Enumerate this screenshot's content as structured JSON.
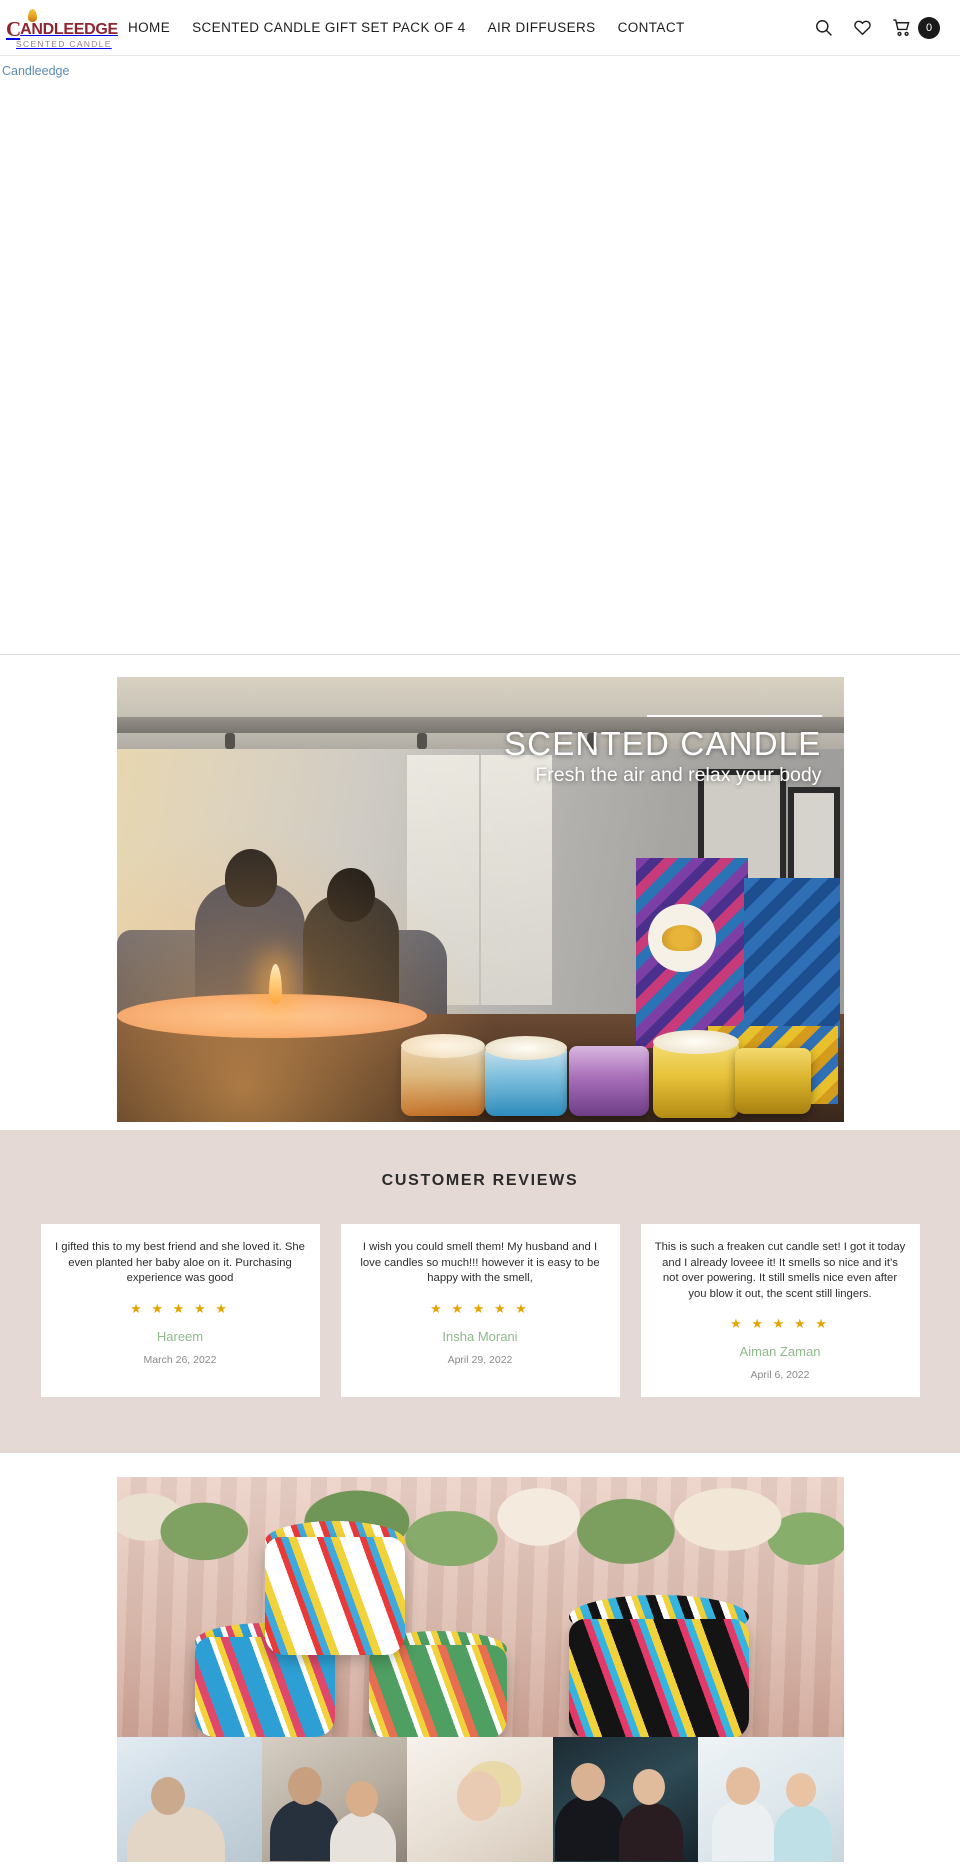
{
  "header": {
    "logo": {
      "initial": "C",
      "name": "ANDLEEDGE",
      "tagline": "SCENTED CANDLE",
      "icon": "candle-flame-icon"
    },
    "nav": [
      {
        "label": "HOME",
        "name": "nav-home"
      },
      {
        "label": "SCENTED CANDLE GIFT SET PACK OF 4",
        "name": "nav-gift-set"
      },
      {
        "label": "AIR DIFFUSERS",
        "name": "nav-air-diffusers"
      },
      {
        "label": "CONTACT",
        "name": "nav-contact"
      }
    ],
    "icons": {
      "search": "search-icon",
      "wishlist": "heart-icon",
      "cart": "shopping-cart-icon"
    },
    "cart_count": "0"
  },
  "breadcrumb": {
    "link_label": "Candleedge"
  },
  "hero": {
    "title": "SCENTED CANDLE",
    "subtitle": "Fresh the air and relax your body"
  },
  "reviews": {
    "heading": "CUSTOMER REVIEWS",
    "items": [
      {
        "text": "I gifted this to my best friend and she loved it. She even planted her baby aloe on it. Purchasing experience was good",
        "stars": "★ ★ ★ ★ ★",
        "author": "Hareem",
        "date": "March 26, 2022"
      },
      {
        "text": "I wish you could smell them! My husband and I love candles so much!!! however it is easy to be happy with the smell,",
        "stars": "★ ★ ★ ★ ★",
        "author": "Insha Morani",
        "date": "April 29, 2022"
      },
      {
        "text": "This is such a freaken cut candle set! I got it today and I already loveee it! It smells so nice and it's not over powering. It still smells nice even after you blow it out, the scent still lingers.",
        "stars": "★ ★ ★ ★ ★",
        "author": "Aiman Zaman",
        "date": "April 6, 2022"
      }
    ]
  },
  "showcase": {
    "banner_name": "candle-tins-photo",
    "lifestyle_tiles": [
      "sleeping-woman-photo",
      "couple-reading-photo",
      "woman-relaxing-photo",
      "couple-dining-photo",
      "women-stretching-photo"
    ]
  },
  "colors": {
    "brand": "#8e2430",
    "review_bg": "#e5d9d5",
    "star": "#e7a400",
    "author": "#8fba8c",
    "link": "#5b8cb5"
  }
}
